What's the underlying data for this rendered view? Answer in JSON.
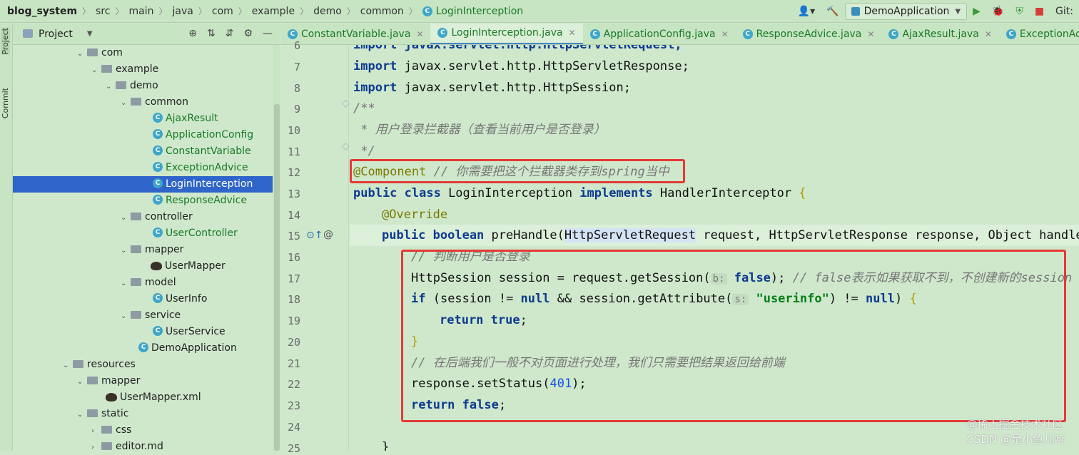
{
  "breadcrumb": {
    "project": "blog_system",
    "parts": [
      "src",
      "main",
      "java",
      "com",
      "example",
      "demo",
      "common"
    ],
    "file": "LoginInterception"
  },
  "toolbar": {
    "run_config": "DemoApplication",
    "vcs_label": "Git:"
  },
  "side_tabs": {
    "project": "Project",
    "commit": "Commit"
  },
  "project_panel": {
    "title": "Project",
    "tree": [
      {
        "label": "com",
        "kind": "folder",
        "depth": 0
      },
      {
        "label": "example",
        "kind": "folder",
        "depth": 1
      },
      {
        "label": "demo",
        "kind": "folder",
        "depth": 2
      },
      {
        "label": "common",
        "kind": "folder",
        "depth": 3
      },
      {
        "label": "AjaxResult",
        "kind": "class",
        "depth": 4
      },
      {
        "label": "ApplicationConfig",
        "kind": "class",
        "depth": 4
      },
      {
        "label": "ConstantVariable",
        "kind": "class",
        "depth": 4
      },
      {
        "label": "ExceptionAdvice",
        "kind": "class",
        "depth": 4
      },
      {
        "label": "LoginInterception",
        "kind": "class",
        "depth": 4,
        "selected": true
      },
      {
        "label": "ResponseAdvice",
        "kind": "class",
        "depth": 4
      },
      {
        "label": "controller",
        "kind": "folder",
        "depth": 3
      },
      {
        "label": "UserController",
        "kind": "class",
        "depth": 4
      },
      {
        "label": "mapper",
        "kind": "folder",
        "depth": 3
      },
      {
        "label": "UserMapper",
        "kind": "mybatis",
        "depth": 4
      },
      {
        "label": "model",
        "kind": "folder",
        "depth": 3
      },
      {
        "label": "UserInfo",
        "kind": "class",
        "depth": 4
      },
      {
        "label": "service",
        "kind": "folder",
        "depth": 3
      },
      {
        "label": "UserService",
        "kind": "class",
        "depth": 4
      },
      {
        "label": "DemoApplication",
        "kind": "app",
        "depth": 3
      },
      {
        "label": "resources",
        "kind": "folder",
        "depth": -1
      },
      {
        "label": "mapper",
        "kind": "folder",
        "depth": 0
      },
      {
        "label": "UserMapper.xml",
        "kind": "mybatis",
        "depth": 1
      },
      {
        "label": "static",
        "kind": "folder",
        "depth": 0
      },
      {
        "label": "css",
        "kind": "folder-collapsed",
        "depth": 1
      },
      {
        "label": "editor.md",
        "kind": "folder-collapsed",
        "depth": 1
      }
    ]
  },
  "editor_tabs": [
    {
      "label": "ConstantVariable.java",
      "active": false
    },
    {
      "label": "LoginInterception.java",
      "active": true
    },
    {
      "label": "ApplicationConfig.java",
      "active": false
    },
    {
      "label": "ResponseAdvice.java",
      "active": false
    },
    {
      "label": "AjaxResult.java",
      "active": false
    },
    {
      "label": "ExceptionAdvice.java",
      "active": false
    }
  ],
  "code": {
    "line_numbers": [
      "6",
      "7",
      "8",
      "9",
      "10",
      "11",
      "12",
      "13",
      "14",
      "15",
      "16",
      "17",
      "18",
      "19",
      "20",
      "21",
      "22",
      "23",
      "24",
      "25"
    ],
    "l6": "import javax.servlet.http.HttpServletRequest;",
    "l7_kw": "import",
    "l7_rest": " javax.servlet.http.HttpServletResponse;",
    "l8_kw": "import",
    "l8_rest": " javax.servlet.http.HttpSession;",
    "l9": "/**",
    "l10": " * 用户登录拦截器（查看当前用户是否登录）",
    "l11": " */",
    "l12_ann": "@Component",
    "l12_cm": " // 你需要把这个拦截器类存到spring当中",
    "l13_kw1": "public class",
    "l13_name": " LoginInterception ",
    "l13_kw2": "implements",
    "l13_rest": " HandlerInterceptor ",
    "l13_brace": "{",
    "l14_ann": "@Override",
    "l15_kw": "public boolean",
    "l15_method": " preHandle(",
    "l15_param": "HttpServletRequest",
    "l15_rest": " request, HttpServletResponse response, Object handler",
    "l16": "// 判断用户是否登录",
    "l17_a": "HttpSession session = request.getSession(",
    "l17_hint": "b:",
    "l17_kw": " false",
    "l17_b": "); ",
    "l17_cm": "// false表示如果获取不到，不创建新的session",
    "l18_kw": "if",
    "l18_a": " (session != ",
    "l18_null": "null",
    "l18_b": " && session.getAttribute(",
    "l18_hint": "s:",
    "l18_str": " \"userinfo\"",
    "l18_c": ") != ",
    "l18_null2": "null",
    "l18_d": ") ",
    "l18_brace": "{",
    "l19_kw": "return true",
    "l19_end": ";",
    "l20": "}",
    "l21": "// 在后端我们一般不对页面进行处理，我们只需要把结果返回给前端",
    "l22_a": "response.setStatus(",
    "l22_num": "401",
    "l22_b": ");",
    "l23_kw": "return false",
    "l23_end": ";",
    "l25": "}"
  },
  "watermark": "@稀土掘金技术社区\nCSDN @是小鱼儿哈",
  "colors": {
    "background": "#cfe8cc",
    "selection": "#2f65ca",
    "annotation_box": "#e53935"
  }
}
